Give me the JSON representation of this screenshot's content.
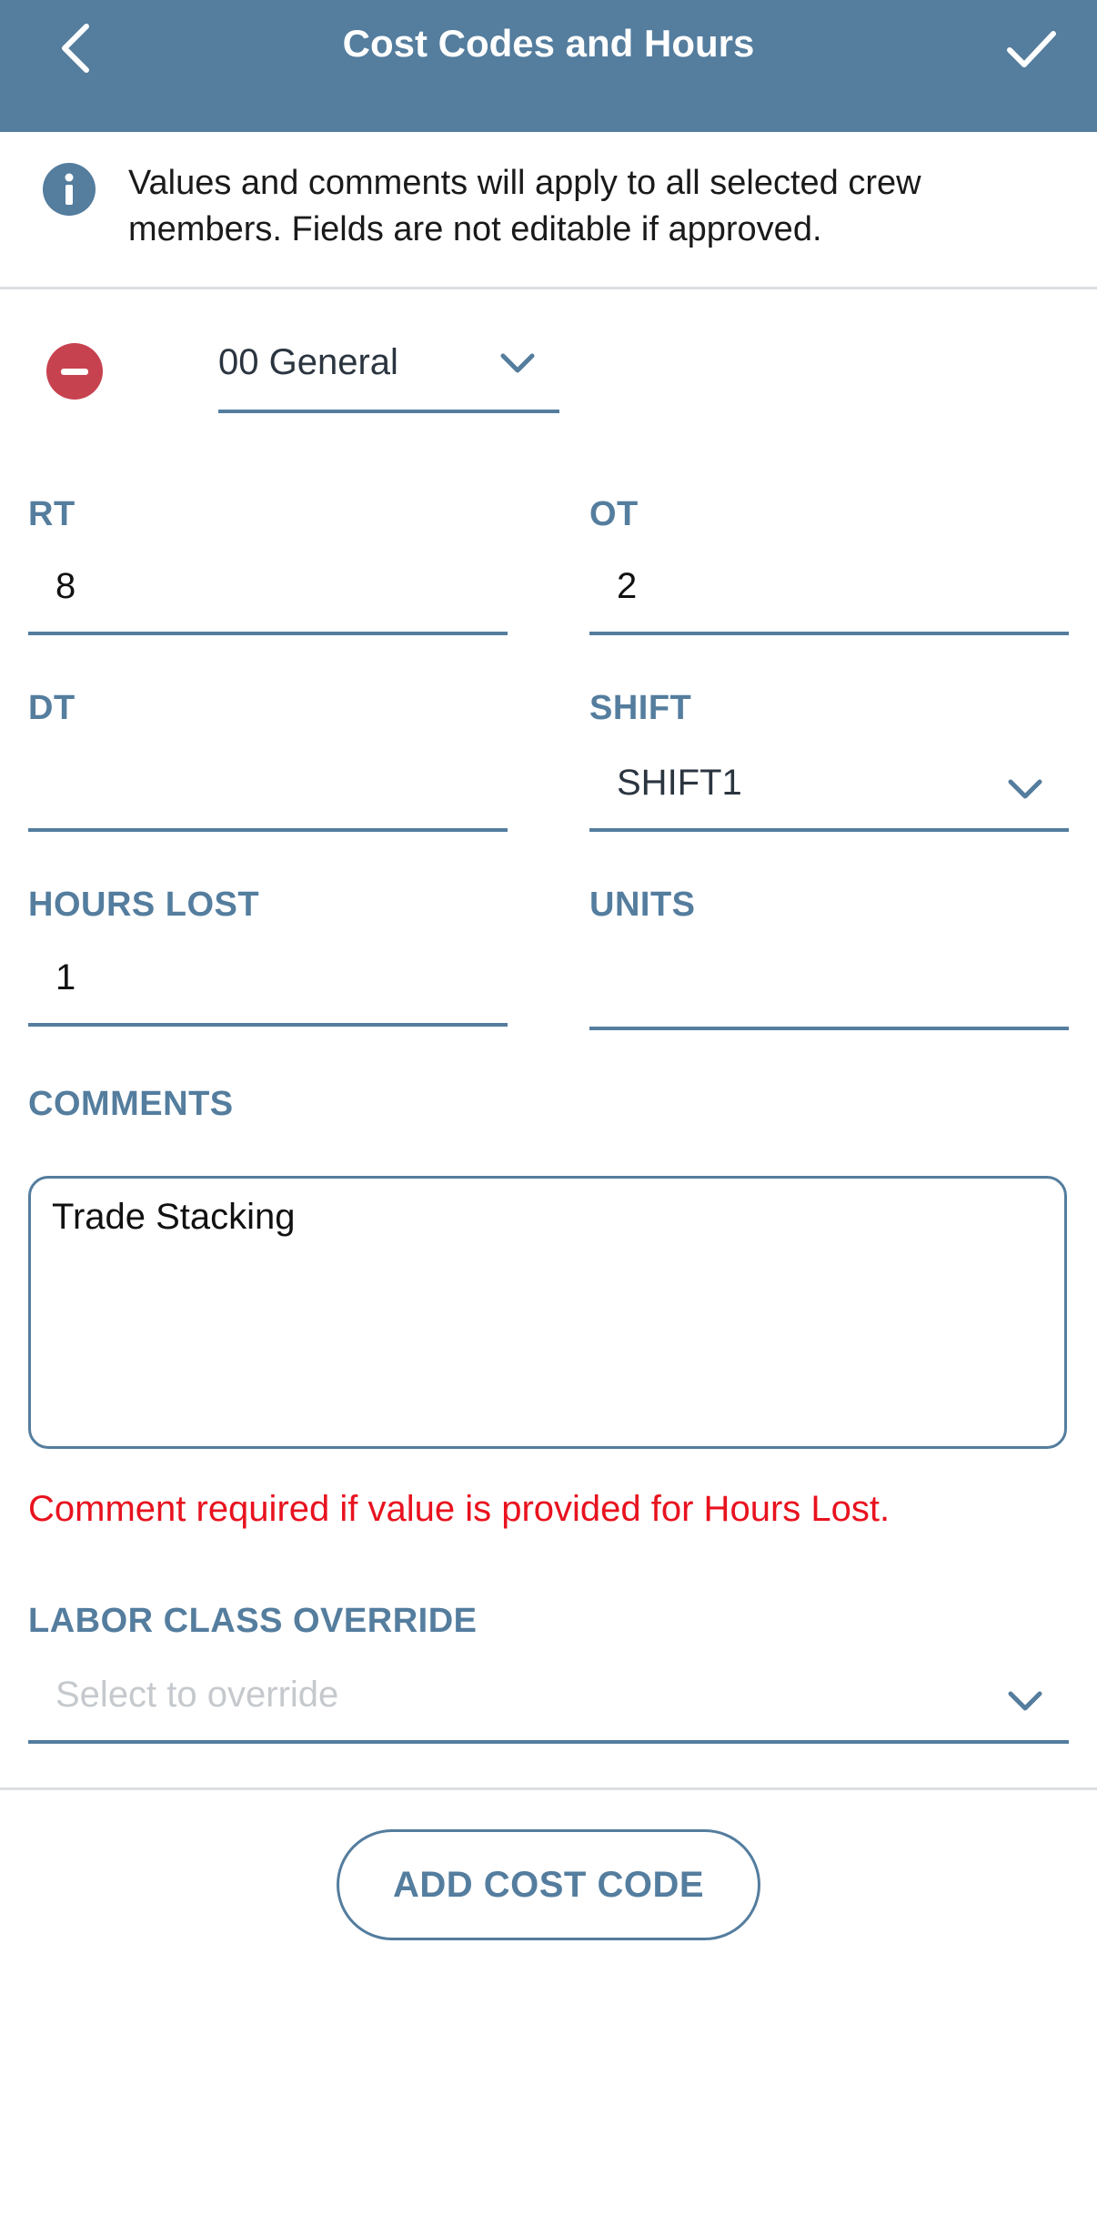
{
  "header": {
    "title": "Cost Codes and Hours",
    "back_icon": "chevron-left-icon",
    "confirm_icon": "checkmark-icon"
  },
  "info": {
    "icon": "info-icon",
    "text": "Values and comments will apply to all selected crew members. Fields are not editable if approved."
  },
  "cost_code": {
    "selected": "00 General",
    "remove_icon": "minus-circle-icon"
  },
  "fields": {
    "rt": {
      "label": "RT",
      "value": "8"
    },
    "ot": {
      "label": "OT",
      "value": "2"
    },
    "dt": {
      "label": "DT",
      "value": ""
    },
    "shift": {
      "label": "SHIFT",
      "value": "SHIFT1"
    },
    "hours_lost": {
      "label": "HOURS LOST",
      "value": "1"
    },
    "units": {
      "label": "UNITS",
      "value": ""
    }
  },
  "comments": {
    "label": "COMMENTS",
    "value": "Trade Stacking",
    "error": "Comment required if value is provided for Hours Lost."
  },
  "labor_class_override": {
    "label": "LABOR CLASS OVERRIDE",
    "placeholder": "Select to override"
  },
  "add_button": {
    "label": "ADD COST CODE"
  },
  "colors": {
    "header_bg": "#547d9e",
    "accent": "#547d9e",
    "remove_red": "#c7424f",
    "error_red": "#e8121e"
  }
}
